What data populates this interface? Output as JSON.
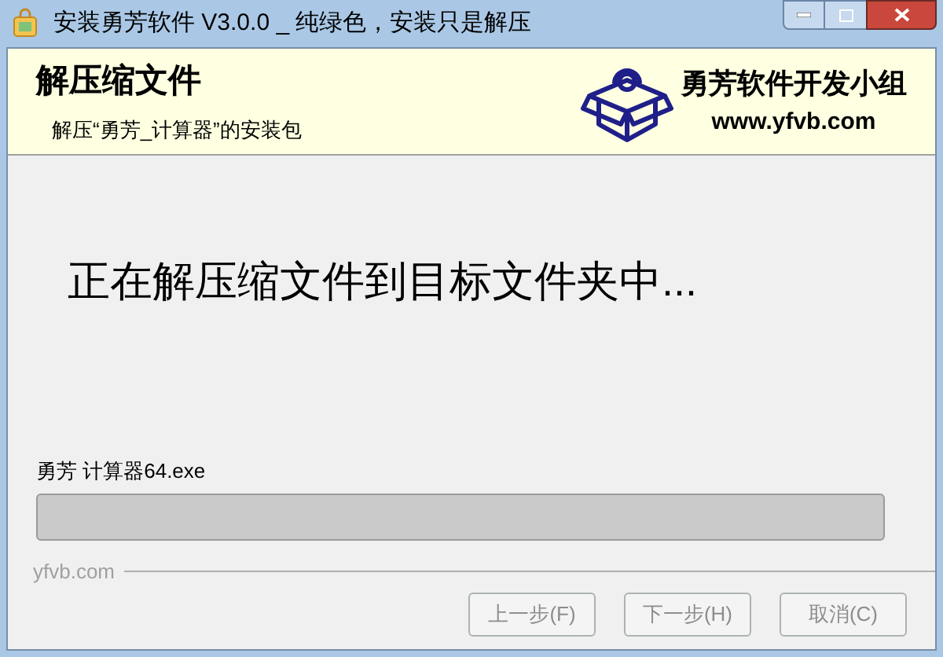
{
  "window": {
    "title": "安装勇芳软件 V3.0.0 _ 纯绿色，安装只是解压"
  },
  "header": {
    "title": "解压缩文件",
    "subtitle": "解压“勇芳_计算器”的安装包",
    "brand": "勇芳软件开发小组",
    "website": "www.yfvb.com"
  },
  "message": "正在解压缩文件到目标文件夹中...",
  "current_file": "勇芳 计算器64.exe",
  "footer_brand": "yfvb.com",
  "buttons": [
    {
      "label": "上一步(F)",
      "disabled": true
    },
    {
      "label": "下一步(H)",
      "disabled": true
    },
    {
      "label": "取消(C)",
      "disabled": true
    }
  ]
}
